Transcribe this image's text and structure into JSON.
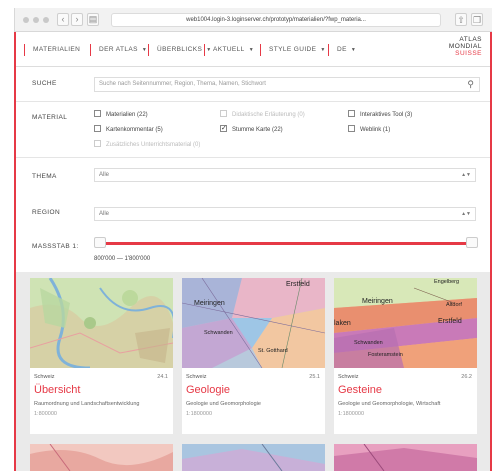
{
  "browser": {
    "url": "web1004.login-3.loginserver.ch/prototyp/materialien/?fwp_materia..."
  },
  "nav": {
    "items": [
      {
        "label": "MATERIALIEN",
        "caret": false
      },
      {
        "label": "DER ATLAS",
        "caret": true
      },
      {
        "label": "ÜBERBLICKS",
        "caret": true
      },
      {
        "label": "AKTUELL",
        "caret": true
      },
      {
        "label": "STYLE GUIDE",
        "caret": true
      },
      {
        "label": "DE",
        "caret": true
      }
    ],
    "logo_line1": "ATLAS",
    "logo_line2": "MONDIAL",
    "logo_line3": "SUISSE"
  },
  "filters": {
    "search_label": "SUCHE",
    "search_placeholder": "Suche nach Seitennummer, Region, Thema, Namen, Stichwort",
    "material_label": "MATERIAL",
    "checkboxes": [
      {
        "label": "Materialien (22)",
        "checked": false,
        "disabled": false
      },
      {
        "label": "Didaktische Erläuterung (0)",
        "checked": false,
        "disabled": true
      },
      {
        "label": "Interaktives Tool (3)",
        "checked": false,
        "disabled": false
      },
      {
        "label": "Kartenkommentar (5)",
        "checked": false,
        "disabled": false
      },
      {
        "label": "Stumme Karte (22)",
        "checked": true,
        "disabled": false
      },
      {
        "label": "Weblink (1)",
        "checked": false,
        "disabled": false
      },
      {
        "label": "Zusätzliches Unterrichtsmaterial (0)",
        "checked": false,
        "disabled": true
      }
    ],
    "thema_label": "THEMA",
    "thema_value": "Alle",
    "region_label": "REGION",
    "region_value": "Alle",
    "massstab_label": "MASSSTAB 1:",
    "massstab_value": "800'000 — 1'800'000"
  },
  "cards": [
    {
      "region": "Schweiz",
      "number": "24.1",
      "title": "Übersicht",
      "subtitle": "Raumordnung und Landschaftsentwicklung",
      "scale": "1:800000",
      "map_labels": []
    },
    {
      "region": "Schweiz",
      "number": "25.1",
      "title": "Geologie",
      "subtitle": "Geologie und Geomorphologie",
      "scale": "1:1800000",
      "map_labels": [
        "Erstfeld",
        "Meiringen",
        "Schwanden",
        "St. Gotthard"
      ]
    },
    {
      "region": "Schweiz",
      "number": "26.2",
      "title": "Gesteine",
      "subtitle": "Geologie und Geomorphologie, Wirtschaft",
      "scale": "1:1800000",
      "map_labels": [
        "Engelberg",
        "Meiringen",
        "Altdorf",
        "Erstfeld",
        "laken",
        "Schwanden",
        "Fosteramstein"
      ]
    }
  ],
  "colors": {
    "accent": "#e63946"
  }
}
